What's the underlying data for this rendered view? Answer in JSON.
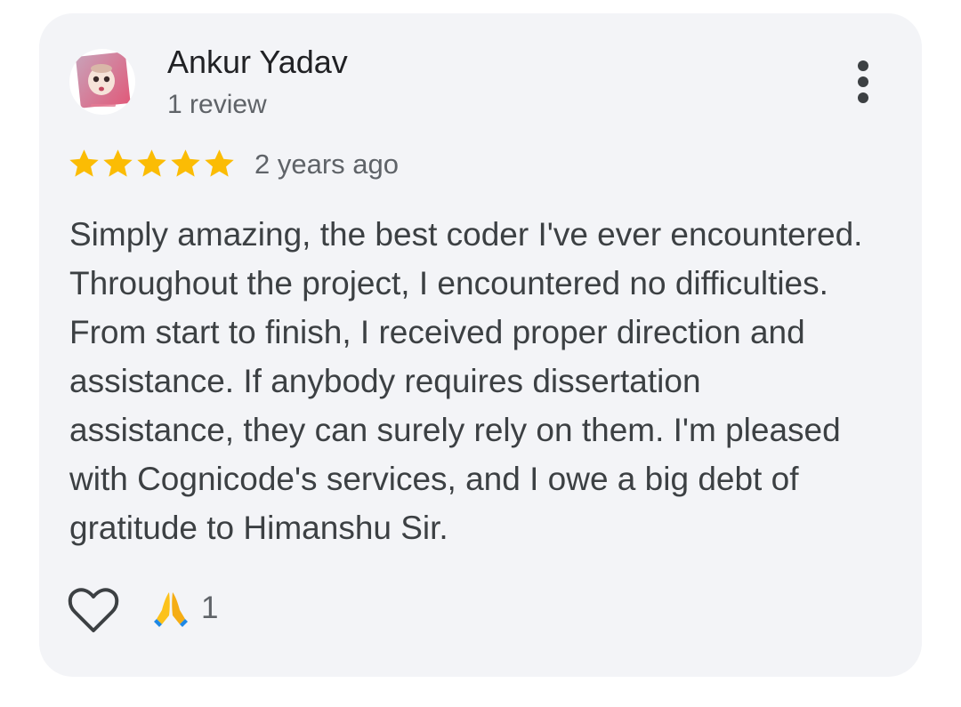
{
  "review": {
    "author_name": "Ankur Yadav",
    "author_meta": "1 review",
    "rating": 5,
    "rating_max": 5,
    "date": "2 years ago",
    "text": "Simply amazing, the best coder I've ever encountered.\nThroughout the project, I encountered no difficulties.\nFrom start to finish, I received proper direction and\nassistance. If anybody requires dissertation\nassistance, they can surely rely on them. I'm pleased\nwith Cognicode's services, and I owe a big debt of\ngratitude to Himanshu Sir.",
    "reaction": {
      "emoji": "folded-hands-emoji",
      "count": "1"
    }
  },
  "icons": {
    "more": "more-vert-icon",
    "like": "heart-outline-icon",
    "star": "star-icon"
  },
  "colors": {
    "card_background": "#f3f4f7",
    "star": "#fbbc04",
    "text_primary": "#202124",
    "text_secondary": "#5f6368",
    "body_text": "#3c4043"
  }
}
